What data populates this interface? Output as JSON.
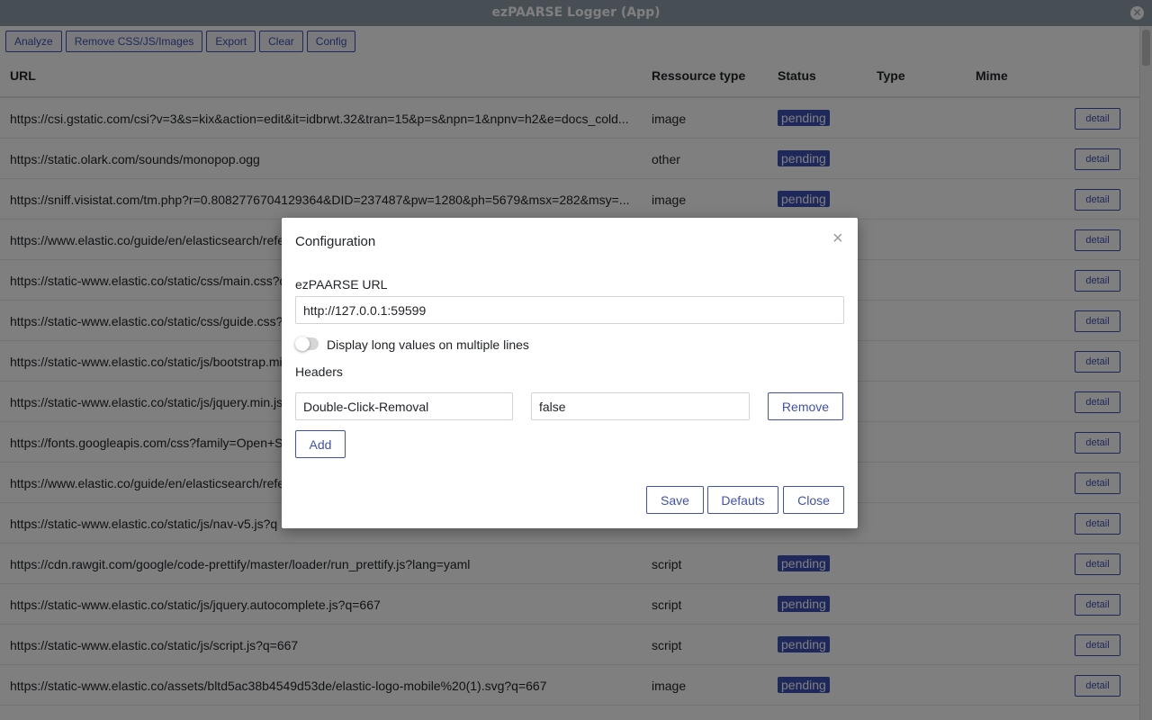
{
  "window": {
    "title": "ezPAARSE Logger (App)"
  },
  "toolbar": {
    "analyze": "Analyze",
    "remove_assets": "Remove CSS/JS/Images",
    "export": "Export",
    "clear": "Clear",
    "config": "Config"
  },
  "table": {
    "columns": {
      "url": "URL",
      "resource_type": "Ressource type",
      "status": "Status",
      "type": "Type",
      "mime": "Mime"
    },
    "rows": [
      {
        "url": "https://csi.gstatic.com/csi?v=3&s=kix&action=edit&it=idbrwt.32&tran=15&p=s&npn=1&npnv=h2&e=docs_cold...",
        "rtype": "image",
        "status": "pending",
        "detail": "detail"
      },
      {
        "url": "https://static.olark.com/sounds/monopop.ogg",
        "rtype": "other",
        "status": "pending",
        "detail": "detail"
      },
      {
        "url": "https://sniff.visistat.com/tm.php?r=0.8082776704129364&DID=237487&pw=1280&ph=5679&msx=282&msy=...",
        "rtype": "image",
        "status": "pending",
        "detail": "detail"
      },
      {
        "url": "https://www.elastic.co/guide/en/elasticsearch/refe",
        "rtype": "",
        "status": "",
        "detail": "detail"
      },
      {
        "url": "https://static-www.elastic.co/static/css/main.css?q",
        "rtype": "",
        "status": "",
        "detail": "detail"
      },
      {
        "url": "https://static-www.elastic.co/static/css/guide.css?q",
        "rtype": "",
        "status": "",
        "detail": "detail"
      },
      {
        "url": "https://static-www.elastic.co/static/js/bootstrap.mi",
        "rtype": "",
        "status": "",
        "detail": "detail"
      },
      {
        "url": "https://static-www.elastic.co/static/js/jquery.min.js",
        "rtype": "",
        "status": "",
        "detail": "detail"
      },
      {
        "url": "https://fonts.googleapis.com/css?family=Open+S",
        "rtype": "",
        "status": "",
        "detail": "detail"
      },
      {
        "url": "https://www.elastic.co/guide/en/elasticsearch/refe",
        "rtype": "",
        "status": "",
        "detail": "detail"
      },
      {
        "url": "https://static-www.elastic.co/static/js/nav-v5.js?q",
        "rtype": "",
        "status": "",
        "detail": "detail"
      },
      {
        "url": "https://cdn.rawgit.com/google/code-prettify/master/loader/run_prettify.js?lang=yaml",
        "rtype": "script",
        "status": "pending",
        "detail": "detail"
      },
      {
        "url": "https://static-www.elastic.co/static/js/jquery.autocomplete.js?q=667",
        "rtype": "script",
        "status": "pending",
        "detail": "detail"
      },
      {
        "url": "https://static-www.elastic.co/static/js/script.js?q=667",
        "rtype": "script",
        "status": "pending",
        "detail": "detail"
      },
      {
        "url": "https://static-www.elastic.co/assets/bltd5ac38b4549d53de/elastic-logo-mobile%20(1).svg?q=667",
        "rtype": "image",
        "status": "pending",
        "detail": "detail"
      },
      {
        "url": "",
        "rtype": "",
        "status": "",
        "detail": ""
      }
    ]
  },
  "modal": {
    "title": "Configuration",
    "close_glyph": "×",
    "url_label": "ezPAARSE URL",
    "url_value": "http://127.0.0.1:59599",
    "multiline_label": "Display long values on multiple lines",
    "multiline_enabled": false,
    "headers_label": "Headers",
    "header_name": "Double-Click-Removal",
    "header_value": "false",
    "remove_label": "Remove",
    "add_label": "Add",
    "save_label": "Save",
    "defaults_label": "Defauts",
    "close_label": "Close"
  },
  "colors": {
    "accent": "#3f51b5",
    "titlebar": "#8e9ea9"
  }
}
